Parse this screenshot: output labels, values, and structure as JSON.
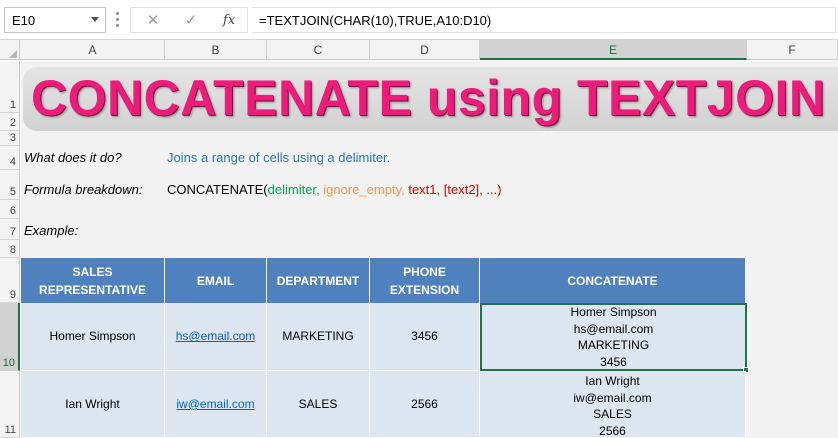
{
  "formula_bar": {
    "name_box": "E10",
    "cancel_icon": "✕",
    "enter_icon": "✓",
    "fx_label": "fx",
    "formula": "=TEXTJOIN(CHAR(10),TRUE,A10:D10)"
  },
  "columns": [
    "A",
    "B",
    "C",
    "D",
    "E",
    "F"
  ],
  "rows": [
    "1",
    "2",
    "3",
    "4",
    "5",
    "6",
    "7",
    "8",
    "9",
    "10",
    "11"
  ],
  "title": "CONCATENATE using TEXTJOIN",
  "what_label": "What does it do?",
  "what_value": "Joins a range of cells using a delimiter.",
  "breakdown_label": "Formula breakdown:",
  "breakdown": {
    "fn": "CONCATENATE(",
    "delimiter": "delimiter",
    "sep1": ", ",
    "ignore_empty": "ignore_empty",
    "sep2": ", ",
    "text1": "text1",
    "sep3": ", ",
    "text2": "[text2]",
    "rest": ", ...)"
  },
  "example_label": "Example:",
  "table": {
    "headers": {
      "rep_line1": "SALES",
      "rep_line2": "REPRESENTATIVE",
      "email": "EMAIL",
      "department": "DEPARTMENT",
      "phone_line1": "PHONE",
      "phone_line2": "EXTENSION",
      "concatenate": "CONCATENATE"
    },
    "rows": [
      {
        "rep": "Homer Simpson",
        "email": "hs@email.com",
        "department": "MARKETING",
        "phone": "3456",
        "concat": [
          "Homer Simpson",
          "hs@email.com",
          "MARKETING",
          "3456"
        ]
      },
      {
        "rep": "Ian Wright",
        "email": "iw@email.com",
        "department": "SALES",
        "phone": "2566",
        "concat": [
          "Ian Wright",
          "iw@email.com",
          "SALES",
          "2566"
        ]
      }
    ]
  },
  "colors": {
    "delimiter": "#00a650",
    "ignore_empty": "#f79646",
    "text_args": "#e00000",
    "description": "#2e75b6",
    "title": "#ed1b7a",
    "header_fill": "#4e81bd",
    "row_fill": "#dce6f1",
    "selection": "#217346"
  }
}
